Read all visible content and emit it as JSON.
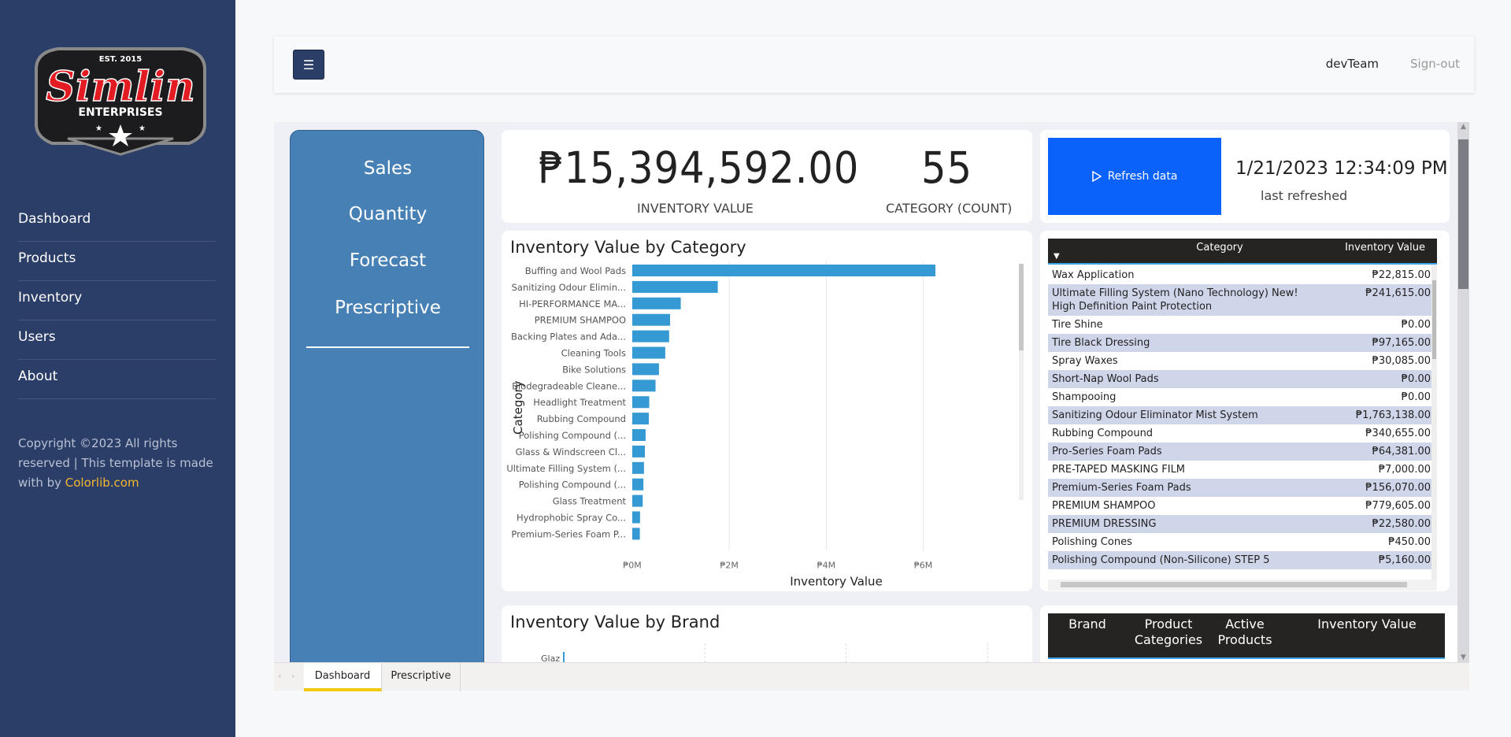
{
  "brand": {
    "est": "EST. 2015",
    "name": "Simlin",
    "sub": "ENTERPRISES"
  },
  "sidebar": {
    "items": [
      {
        "label": "Dashboard"
      },
      {
        "label": "Products"
      },
      {
        "label": "Inventory"
      },
      {
        "label": "Users"
      },
      {
        "label": "About"
      }
    ],
    "copyright_prefix": "Copyright ©2023 All rights reserved | This template is made with by ",
    "copyright_link": "Colorlib.com"
  },
  "topbar": {
    "menu_icon": "☰",
    "user": "devTeam",
    "signout": "Sign-out"
  },
  "report_nav": {
    "links": [
      "Sales",
      "Quantity",
      "Forecast",
      "Prescriptive"
    ]
  },
  "kpis": {
    "inventory_value": "₱15,394,592.00",
    "inventory_value_label": "INVENTORY VALUE",
    "category_count": "55",
    "category_count_label": "CATEGORY (COUNT)"
  },
  "refresh": {
    "button_label": "Refresh data",
    "date": "1/21/2023 12:34:09 PM",
    "sub": "last refreshed"
  },
  "category_table": {
    "headers": [
      "Category",
      "Inventory Value"
    ],
    "rows": [
      {
        "category": "Wax Application",
        "value": "₱22,815.00"
      },
      {
        "category": "Ultimate Filling System (Nano Technology) New! High Definition Paint Protection",
        "value": "₱241,615.00"
      },
      {
        "category": "Tire Shine",
        "value": "₱0.00"
      },
      {
        "category": "Tire Black Dressing",
        "value": "₱97,165.00"
      },
      {
        "category": "Spray Waxes",
        "value": "₱30,085.00"
      },
      {
        "category": "Short-Nap Wool Pads",
        "value": "₱0.00"
      },
      {
        "category": "Shampooing",
        "value": "₱0.00"
      },
      {
        "category": "Sanitizing Odour Eliminator Mist System",
        "value": "₱1,763,138.00"
      },
      {
        "category": "Rubbing Compound",
        "value": "₱340,655.00"
      },
      {
        "category": "Pro-Series Foam Pads",
        "value": "₱64,381.00"
      },
      {
        "category": "PRE-TAPED MASKING FILM",
        "value": "₱7,000.00"
      },
      {
        "category": "Premium-Series Foam Pads",
        "value": "₱156,070.00"
      },
      {
        "category": "PREMIUM SHAMPOO",
        "value": "₱779,605.00"
      },
      {
        "category": "PREMIUM DRESSING",
        "value": "₱22,580.00"
      },
      {
        "category": "Polishing Cones",
        "value": "₱450.00"
      },
      {
        "category": "Polishing Compound (Non-Silicone) STEP 5",
        "value": "₱5,160.00"
      }
    ]
  },
  "brand_table": {
    "headers": [
      "Brand",
      "Product Categories",
      "Active Products",
      "Inventory Value"
    ]
  },
  "brand_chart": {
    "title": "Inventory Value by Brand",
    "first_label": "Glaz"
  },
  "page_tabs": [
    "Dashboard",
    "Prescriptive"
  ],
  "chart_data": {
    "type": "bar",
    "orientation": "horizontal",
    "title": "Inventory Value by Category",
    "xlabel": "Inventory Value",
    "ylabel": "Category",
    "xlim": [
      0,
      7000000
    ],
    "xticks": [
      0,
      2000000,
      4000000,
      6000000
    ],
    "xtick_labels": [
      "₱0M",
      "₱2M",
      "₱4M",
      "₱6M"
    ],
    "grid": true,
    "color": "#3599d3",
    "categories": [
      "Buffing and Wool Pads",
      "Sanitizing Odour Elimin...",
      "HI-PERFORMANCE MA...",
      "PREMIUM SHAMPOO",
      "Backing Plates and Ada...",
      "Cleaning Tools",
      "Bike Solutions",
      "Biodegradeable Cleane...",
      "Headlight Treatment",
      "Rubbing Compound",
      "Polishing Compound (...",
      "Glass & Windscreen Cl...",
      "Ultimate Filling System (...",
      "Polishing Compound (...",
      "Glass Treatment",
      "Hydrophobic Spray Co...",
      "Premium-Series Foam P..."
    ],
    "values": [
      6250000,
      1763138,
      1000000,
      779605,
      760000,
      680000,
      550000,
      480000,
      350000,
      340655,
      275000,
      260000,
      241615,
      230000,
      215000,
      160000,
      156070
    ]
  }
}
